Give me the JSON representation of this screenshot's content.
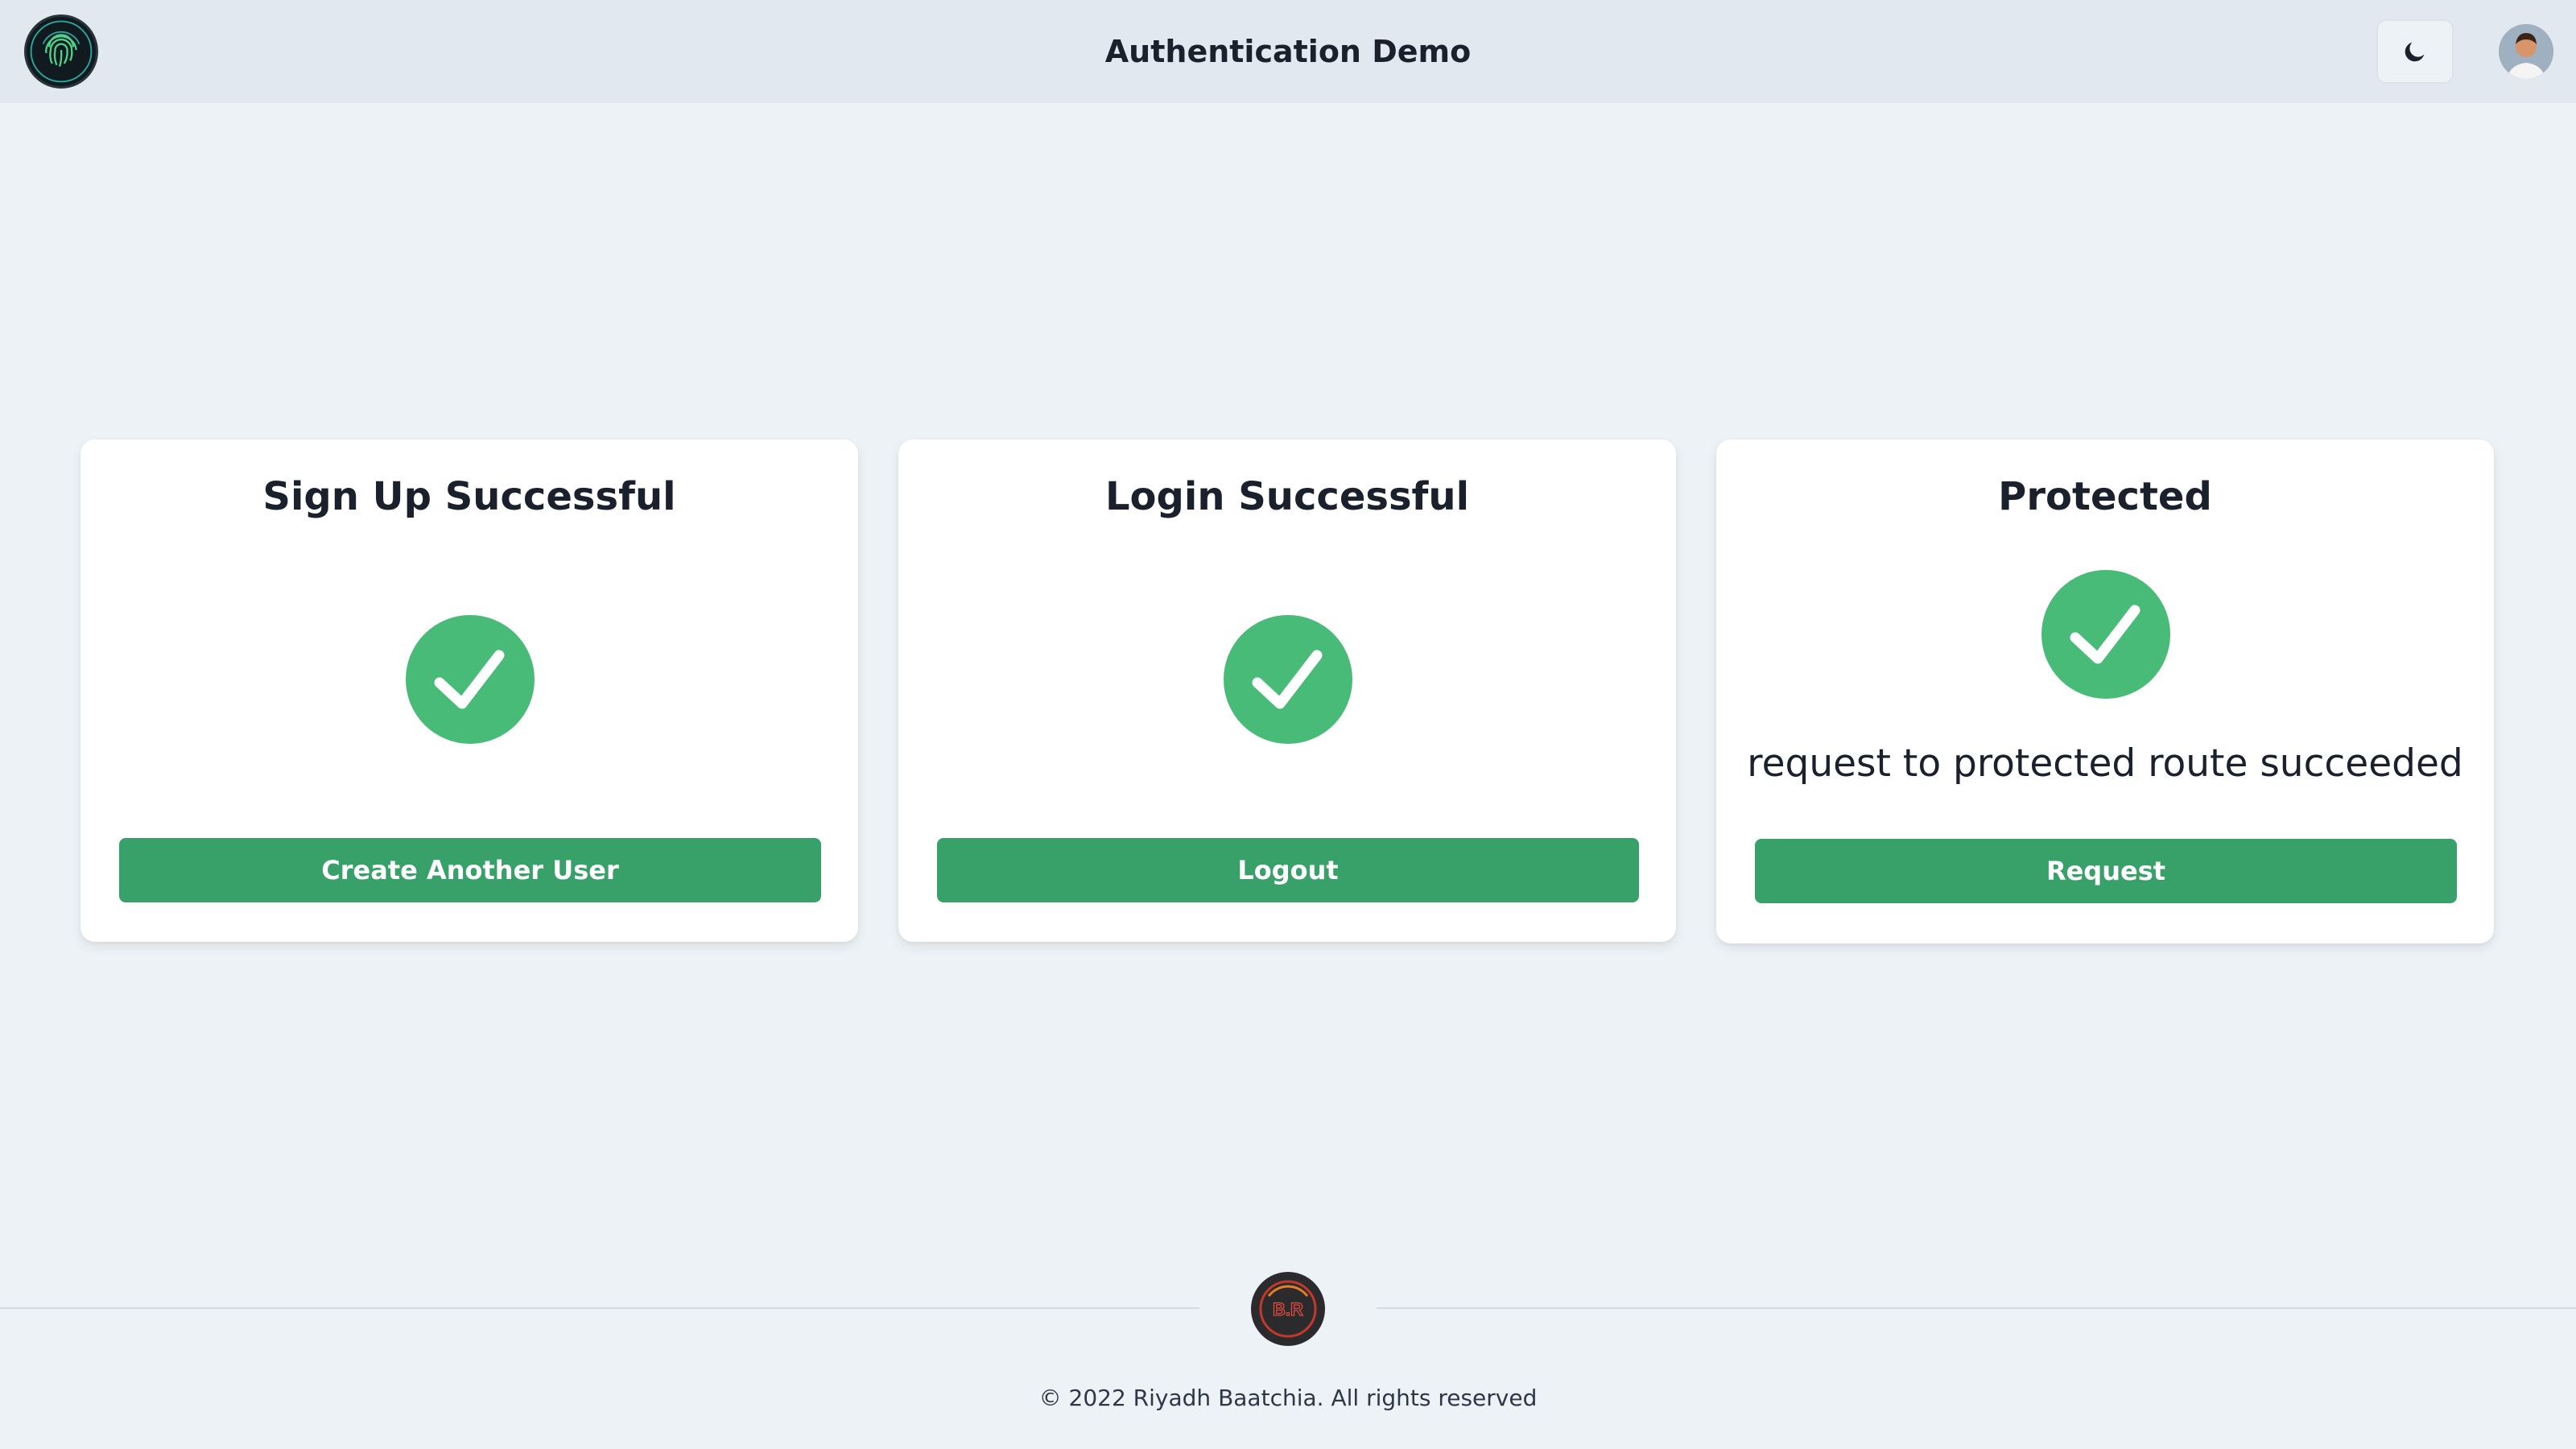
{
  "header": {
    "title": "Authentication Demo",
    "logo_icon": "fingerprint-icon",
    "theme_toggle_icon": "moon-icon",
    "avatar_icon": "user-avatar"
  },
  "cards": [
    {
      "title": "Sign Up Successful",
      "status_icon": "check-circle-icon",
      "button_label": "Create Another User"
    },
    {
      "title": "Login Successful",
      "status_icon": "check-circle-icon",
      "button_label": "Logout"
    },
    {
      "title": "Protected",
      "status_icon": "check-circle-icon",
      "message": "request to protected route succeeded",
      "button_label": "Request"
    }
  ],
  "footer": {
    "logo_text": "B.R",
    "copyright": "© 2022 Riyadh Baatchia. All rights reserved"
  },
  "colors": {
    "background": "#edf2f7",
    "header_background": "#e2e8f0",
    "button": "#38a169",
    "check_circle": "#48bb78",
    "text": "#1a202c"
  }
}
